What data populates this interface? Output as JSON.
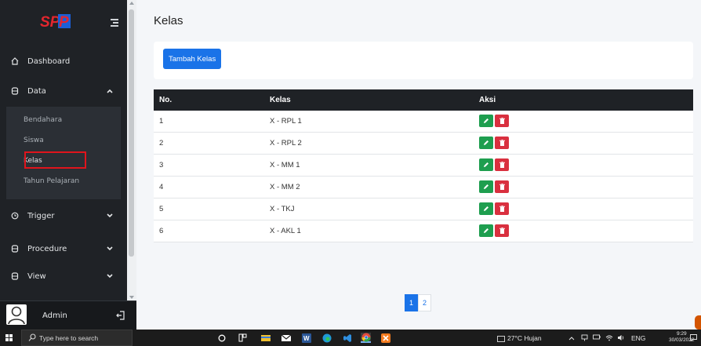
{
  "sidebar": {
    "logo_text": "SPP",
    "menu": {
      "dashboard": "Dashboard",
      "data": "Data",
      "trigger": "Trigger",
      "procedure": "Procedure",
      "view": "View"
    },
    "data_submenu": [
      "Bendahara",
      "Siswa",
      "Kelas",
      "Tahun Pelajaran"
    ],
    "active_item": "Kelas",
    "user": "Admin"
  },
  "main": {
    "title": "Kelas",
    "add_button": "Tambah Kelas",
    "table": {
      "headers": [
        "No.",
        "Kelas",
        "Aksi"
      ],
      "rows": [
        {
          "no": "1",
          "kelas": "X - RPL 1"
        },
        {
          "no": "2",
          "kelas": "X - RPL 2"
        },
        {
          "no": "3",
          "kelas": "X - MM 1"
        },
        {
          "no": "4",
          "kelas": "X - MM 2"
        },
        {
          "no": "5",
          "kelas": "X - TKJ"
        },
        {
          "no": "6",
          "kelas": "X - AKL 1"
        }
      ]
    },
    "pagination": [
      "1",
      "2"
    ],
    "current_page": "1"
  },
  "taskbar": {
    "search_placeholder": "Type here to search",
    "weather": "27°C Hujan",
    "language": "ENG",
    "time": "9:29",
    "date": "30/03/2022"
  },
  "colors": {
    "sidebar_bg": "#1f2226",
    "primary": "#1a73e8",
    "edit": "#1e9e4f",
    "delete": "#d9303f",
    "highlight": "#e0141c"
  }
}
